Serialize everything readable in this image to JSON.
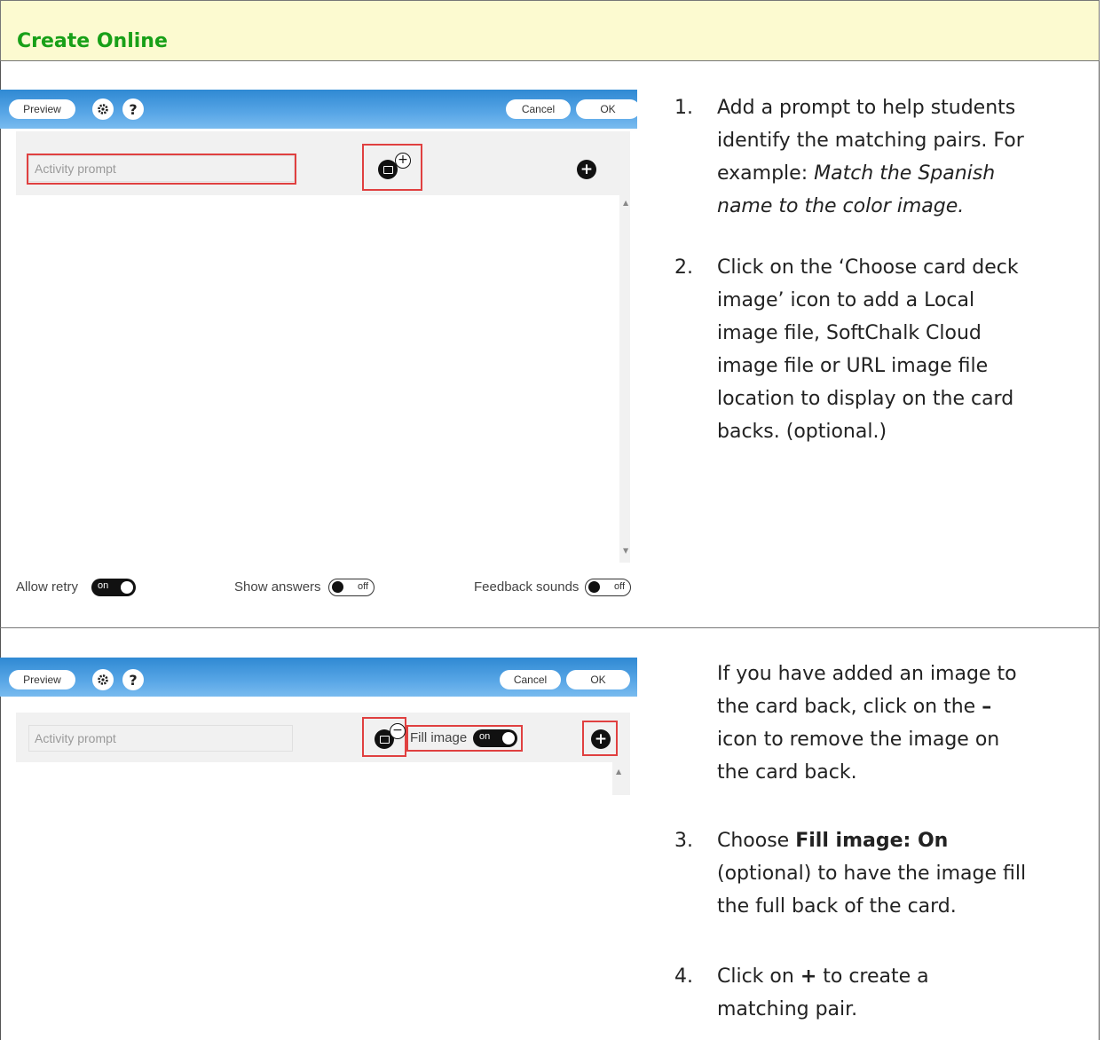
{
  "header": {
    "title": "Create Online"
  },
  "editor1": {
    "toolbar": {
      "preview_label": "Preview",
      "gear_icon": "gear-icon",
      "help_label": "?",
      "cancel_label": "Cancel",
      "ok_label": "OK"
    },
    "prompt_placeholder": "Activity prompt",
    "image_badge": "+",
    "add_label": "+",
    "footer": {
      "allow_retry_label": "Allow retry",
      "allow_retry_state": "on",
      "show_answers_label": "Show answers",
      "show_answers_state": "off",
      "feedback_sounds_label": "Feedback sounds",
      "feedback_sounds_state": "off"
    }
  },
  "editor2": {
    "toolbar": {
      "preview_label": "Preview",
      "gear_icon": "gear-icon",
      "help_label": "?",
      "cancel_label": "Cancel",
      "ok_label": "OK"
    },
    "prompt_placeholder": "Activity prompt",
    "image_badge": "−",
    "fill_image_label": "Fill image",
    "fill_image_state": "on",
    "add_label": "+"
  },
  "instructions": {
    "step1": {
      "num": "1.",
      "line1": "Add a prompt to help students",
      "line2": "identify the matching pairs. For",
      "line3_plain": "example: ",
      "line3_italic": "Match the Spanish",
      "line4_italic": "name to the color image."
    },
    "step2": {
      "num": "2.",
      "lines": [
        "Click on the ‘Choose card deck",
        "image’ icon to add a Local",
        "image file, SoftChalk Cloud",
        "image file or URL image file",
        "location to display on the card",
        "backs. (optional.)"
      ]
    },
    "note": {
      "line1": "If you have added an image to",
      "line2_plain": "the card back, click on the ",
      "line2_bold": "–",
      "line3": "icon to remove the image on",
      "line4": "the card back."
    },
    "step3": {
      "num": "3.",
      "line1_plain": "Choose ",
      "line1_bold": "Fill image: On",
      "line2": "(optional) to have the image fill",
      "line3": "the full back of the card."
    },
    "step4": {
      "num": "4.",
      "line1_plain": "Click on ",
      "line1_bold": "+",
      "line1_rest": " to create a",
      "line2": "matching pair."
    }
  }
}
